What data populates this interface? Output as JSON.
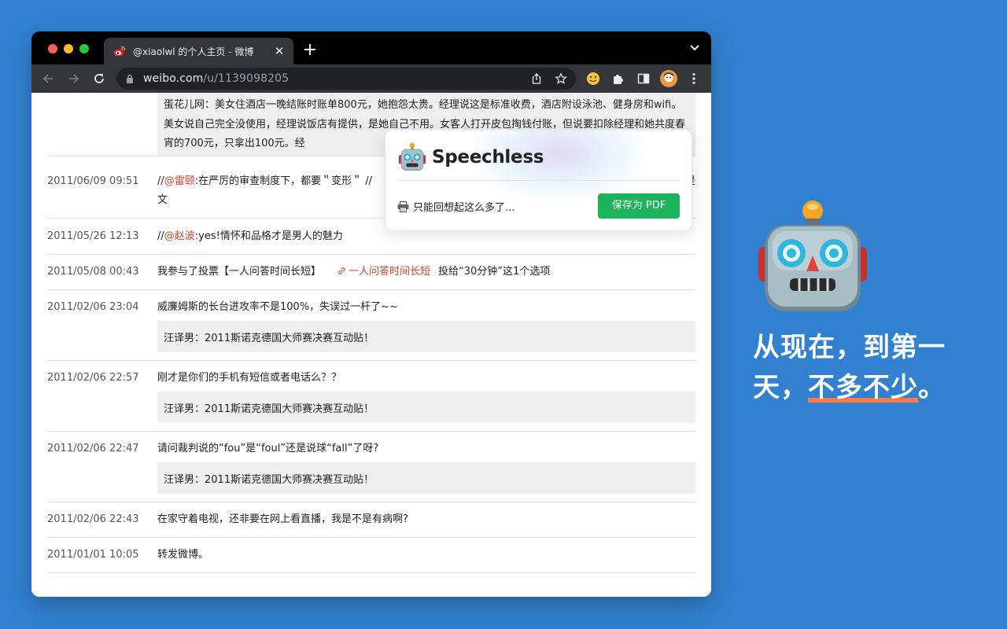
{
  "browser": {
    "tab_title": "@xiaolwl 的个人主页 - 微博",
    "url_host": "weibo.com",
    "url_path": "/u/1139098205"
  },
  "feed": {
    "first_quote": "蛋花儿网：美女住酒店一晚结账时账单800元，她抱怨太贵。经理说这是标准收费，酒店附设泳池、健身房和wifi。美女说自己完全没使用，经理说饭店有提供，是她自己不用。女客人打开皮包掏钱付账，但说要扣除经理和她共度春宵的700元，只拿出100元。经",
    "posts": [
      {
        "date": "2011/06/09 09:51",
        "prefix": "//",
        "mention": "@雷颐",
        "text": ":在严厉的审查制度下，都要＂变形＂ //",
        "text_tail": "是",
        "line2": "文"
      },
      {
        "date": "2011/05/26 12:13",
        "prefix": "//",
        "mention": "@赵波",
        "text": ":yes!情怀和品格才是男人的魅力"
      },
      {
        "date": "2011/05/08 00:43",
        "text": "我参与了投票【一人问答时间长短】",
        "link": "一人问答时间长短",
        "text_after": "投给“30分钟”这1个选项"
      },
      {
        "date": "2011/02/06 23:04",
        "text": "威廉姆斯的长台进攻率不是100%，失误过一杆了~~",
        "quote": "汪译男：2011斯诺克德国大师赛决赛互动贴！"
      },
      {
        "date": "2011/02/06 22:57",
        "text": "刚才是你们的手机有短信或者电话么？？",
        "quote": "汪译男：2011斯诺克德国大师赛决赛互动贴！"
      },
      {
        "date": "2011/02/06 22:47",
        "text": "请问裁判说的“fou”是“foul”还是说球“fall”了呀?",
        "quote": "汪译男：2011斯诺克德国大师赛决赛互动贴！"
      },
      {
        "date": "2011/02/06 22:43",
        "text": "在家守着电视，还非要在网上看直播，我是不是有病啊?"
      },
      {
        "date": "2011/01/01 10:05",
        "text": "转发微博。"
      }
    ]
  },
  "popup": {
    "title": "Speechless",
    "status": "只能回想起这么多了...",
    "save_label": "保存为 PDF",
    "accent": "#1db35c"
  },
  "promo": {
    "line1": "从现在，到第一",
    "line2_pre": "天，",
    "line2_highlight": "不多不少",
    "line2_post": "。",
    "highlight_color": "#ff7a45",
    "background": "#3280d0"
  }
}
